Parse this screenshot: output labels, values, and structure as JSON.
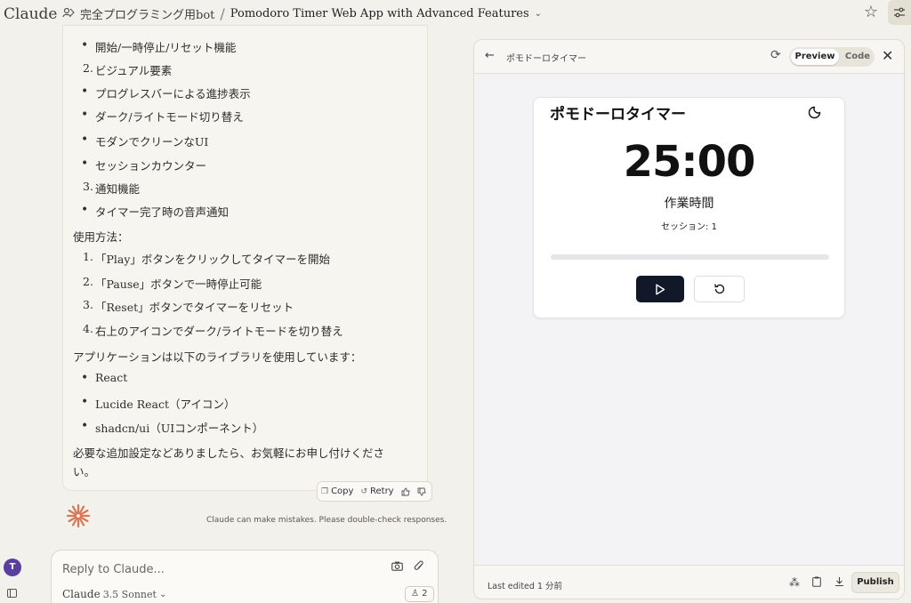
{
  "app": {
    "logo": "Claude",
    "project_name": "完全プログラミング用bot",
    "separator": "/",
    "conversation_title": "Pomodoro Timer Web App with Advanced Features"
  },
  "chat": {
    "lines": [
      {
        "kind": "bullet",
        "text": "開始/一時停止/リセット機能"
      },
      {
        "kind": "num",
        "num": "2.",
        "text": "ビジュアル要素"
      },
      {
        "kind": "bullet",
        "text": "プログレスバーによる進捗表示"
      },
      {
        "kind": "bullet",
        "text": "ダーク/ライトモード切り替え"
      },
      {
        "kind": "bullet",
        "text": "モダンでクリーンなUI"
      },
      {
        "kind": "bullet",
        "text": "セッションカウンター"
      },
      {
        "kind": "num",
        "num": "3.",
        "text": "通知機能"
      },
      {
        "kind": "bullet",
        "text": "タイマー完了時の音声通知"
      },
      {
        "kind": "para",
        "text": "使用方法："
      },
      {
        "kind": "num",
        "num": "1.",
        "text": "「Play」ボタンをクリックしてタイマーを開始"
      },
      {
        "kind": "num",
        "num": "2.",
        "text": "「Pause」ボタンで一時停止可能"
      },
      {
        "kind": "num",
        "num": "3.",
        "text": "「Reset」ボタンでタイマーをリセット"
      },
      {
        "kind": "num",
        "num": "4.",
        "text": "右上のアイコンでダーク/ライトモードを切り替え"
      },
      {
        "kind": "para",
        "text": "アプリケーションは以下のライブラリを使用しています："
      },
      {
        "kind": "bullet",
        "text": "React"
      },
      {
        "kind": "bullet",
        "text": "Lucide React（アイコン）"
      },
      {
        "kind": "bullet",
        "text": "shadcn/ui（UIコンポーネント）"
      },
      {
        "kind": "para",
        "text": "必要な追加設定などありましたら、お気軽にお申し付けくださ"
      },
      {
        "kind": "para",
        "text": "い。"
      }
    ],
    "actions": {
      "copy": "Copy",
      "retry": "Retry"
    },
    "disclaimer": "Claude can make mistakes. Please double-check responses."
  },
  "user": {
    "avatar_initial": "T"
  },
  "composer": {
    "placeholder": "Reply to Claude...",
    "model_name": "Claude",
    "model_version": "3.5 Sonnet",
    "project_count": "2"
  },
  "artifact": {
    "title": "ポモドーロタイマー",
    "tabs": {
      "preview": "Preview",
      "code": "Code"
    },
    "active_tab": "preview",
    "footer": {
      "last_edited": "Last edited 1 分前",
      "publish": "Publish"
    }
  },
  "timer": {
    "title": "ポモドーロタイマー",
    "display": "25:00",
    "mode": "作業時間",
    "session": "セッション: 1",
    "progress": 0
  },
  "colors": {
    "accent": "#d97757",
    "play_button": "#111827",
    "avatar": "#5a3fa0"
  },
  "icons": [
    "project-icon",
    "chevron-down-icon",
    "star-icon",
    "settings-sliders-icon",
    "copy-icon",
    "retry-icon",
    "thumbs-up-icon",
    "thumbs-down-icon",
    "camera-icon",
    "paperclip-icon",
    "back-arrow-icon",
    "refresh-icon",
    "close-icon",
    "moon-icon",
    "play-icon",
    "reset-icon",
    "translate-icon",
    "clipboard-icon",
    "download-icon"
  ]
}
